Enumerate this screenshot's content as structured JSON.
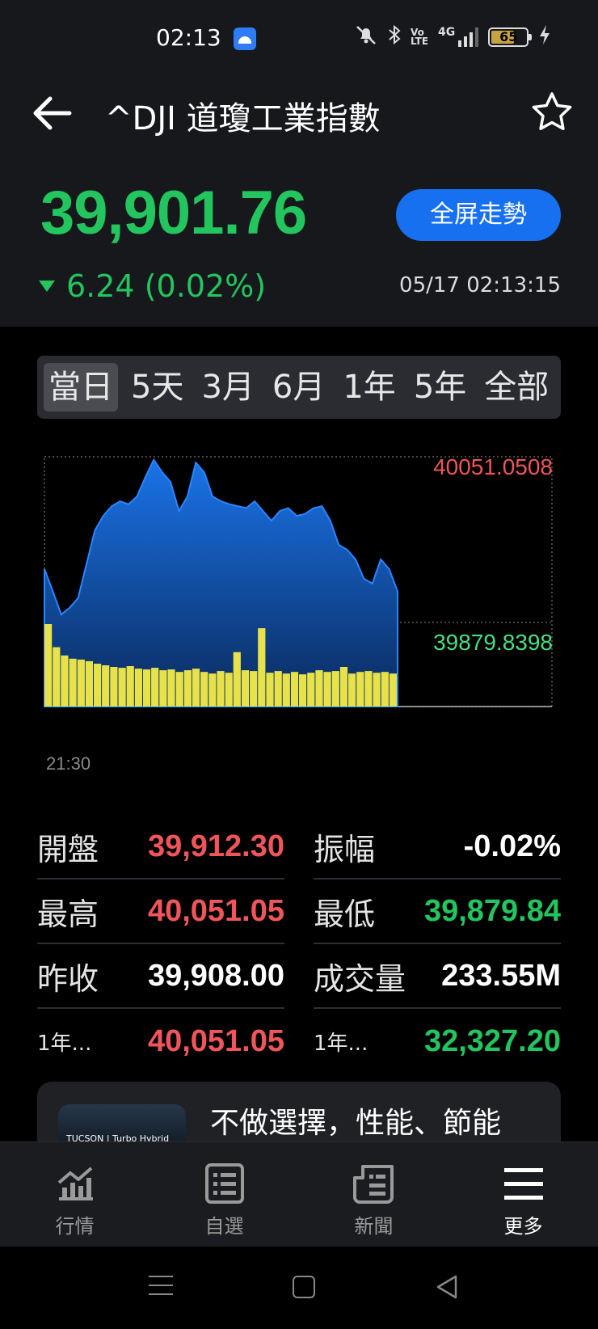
{
  "status_bar": {
    "time": "02:13",
    "battery_level": "65",
    "network": "4G"
  },
  "header": {
    "title": "^DJI 道瓊工業指數",
    "price": "39,901.76",
    "change": "6.24 (0.02%)",
    "change_direction": "down",
    "fullscreen_label": "全屏走勢",
    "timestamp": "05/17 02:13:15"
  },
  "tabs": [
    {
      "label": "當日",
      "active": true
    },
    {
      "label": "5天",
      "active": false
    },
    {
      "label": "3月",
      "active": false
    },
    {
      "label": "6月",
      "active": false
    },
    {
      "label": "1年",
      "active": false
    },
    {
      "label": "5年",
      "active": false
    },
    {
      "label": "全部",
      "active": false
    }
  ],
  "chart_data": {
    "type": "area",
    "high_label": "40051.0508",
    "low_label": "39879.8398",
    "x_start_label": "21:30",
    "ylim": [
      39879.8398,
      40051.0508
    ],
    "colors": {
      "area": "#1a73e8",
      "volume": "#e8e24a",
      "high": "#f0555a",
      "low": "#4ade80"
    },
    "price_series": [
      39935,
      39912,
      39888,
      39895,
      39905,
      39940,
      39975,
      39990,
      40000,
      40005,
      40002,
      40010,
      40030,
      40048,
      40035,
      40025,
      39995,
      40010,
      40045,
      40035,
      40010,
      40005,
      40002,
      40000,
      39998,
      40005,
      39995,
      39985,
      39995,
      39998,
      39990,
      39992,
      39998,
      40000,
      39985,
      39960,
      39955,
      39945,
      39925,
      39920,
      39945,
      39935,
      39912
    ],
    "volume_series": [
      100,
      72,
      62,
      58,
      57,
      55,
      52,
      50,
      48,
      47,
      49,
      46,
      45,
      47,
      44,
      45,
      42,
      44,
      46,
      42,
      40,
      43,
      41,
      66,
      44,
      43,
      95,
      41,
      43,
      40,
      42,
      39,
      41,
      44,
      42,
      43,
      48,
      40,
      42,
      43,
      41,
      42,
      40
    ]
  },
  "stats": [
    [
      {
        "label": "開盤",
        "value": "39,912.30",
        "color": "red"
      },
      {
        "label": "振幅",
        "value": "-0.02%",
        "color": "white"
      }
    ],
    [
      {
        "label": "最高",
        "value": "40,051.05",
        "color": "red"
      },
      {
        "label": "最低",
        "value": "39,879.84",
        "color": "green"
      }
    ],
    [
      {
        "label": "昨收",
        "value": "39,908.00",
        "color": "white"
      },
      {
        "label": "成交量",
        "value": "233.55M",
        "color": "white"
      }
    ],
    [
      {
        "label": "1年...",
        "value": "40,051.05",
        "color": "red"
      },
      {
        "label": "1年...",
        "value": "32,327.20",
        "color": "green"
      }
    ]
  ],
  "ad": {
    "text": "不做選擇，性能、節能",
    "thumb_text": "TUCSON | Turbo Hybrid"
  },
  "bottom_nav": [
    {
      "label": "行情",
      "icon": "chart-icon",
      "active": false
    },
    {
      "label": "自選",
      "icon": "list-icon",
      "active": false
    },
    {
      "label": "新聞",
      "icon": "news-icon",
      "active": false
    },
    {
      "label": "更多",
      "icon": "menu-icon",
      "active": true
    }
  ]
}
